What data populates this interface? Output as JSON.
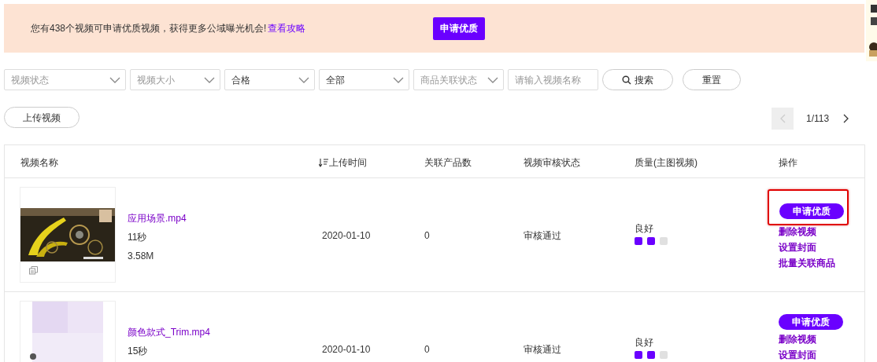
{
  "banner": {
    "message": "您有438个视频可申请优质视频，获得更多公域曝光机会!",
    "link": "查看攻略",
    "button": "申请优质"
  },
  "filters": [
    {
      "kind": "select",
      "placeholder": "视频状态"
    },
    {
      "kind": "select",
      "placeholder": "视频大小"
    },
    {
      "kind": "select",
      "value": "合格"
    },
    {
      "kind": "select",
      "value": "全部"
    },
    {
      "kind": "select",
      "placeholder": "商品关联状态"
    },
    {
      "kind": "input",
      "placeholder": "请输入视频名称"
    }
  ],
  "search_button": "搜索",
  "reset_button": "重置",
  "upload_button": "上传视频",
  "pagination": {
    "page": "1/113",
    "prev_disabled": true
  },
  "table": {
    "columns": [
      "视频名称",
      "上传时间",
      "关联产品数",
      "视频审核状态",
      "质量(主图视频)",
      "操作"
    ],
    "rows": [
      {
        "thumbnail": {
          "kind": "picture"
        },
        "name": "应用场景.mp4",
        "duration": "11秒",
        "size": "3.58M",
        "upload_time": "2020-01-10",
        "products": "0",
        "review_status": "审核通过",
        "quality": "良好",
        "stars": 2,
        "actions": [
          "申请优质",
          "删除视频",
          "设置封面",
          "批量关联商品"
        ],
        "highlighted": true
      },
      {
        "thumbnail": {
          "kind": "picture"
        },
        "name": "颜色款式_Trim.mp4",
        "duration": "15秒",
        "upload_time": "2020-01-10",
        "products": "0",
        "review_status": "审核通过",
        "quality": "良好",
        "stars": 2,
        "actions": [
          "申请优质",
          "删除视频",
          "设置封面"
        ],
        "highlighted": false
      }
    ]
  }
}
